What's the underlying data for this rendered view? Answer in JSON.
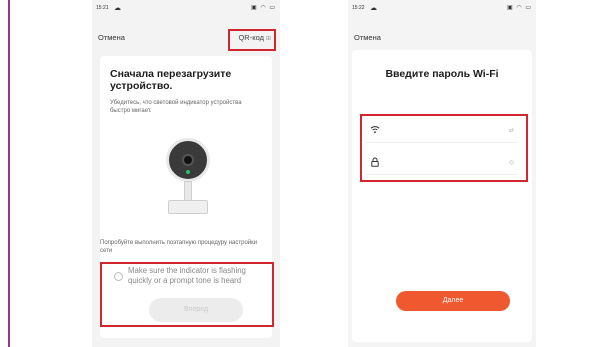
{
  "colors": {
    "highlight_box": "#d0262e",
    "primary_button": "#f0582f",
    "disabled_button": "#ececec",
    "page_rule": "#8e3a8a",
    "camera_led": "#26c46a"
  },
  "screen1": {
    "status": {
      "time": "15:21",
      "left_icon": "weather-icon",
      "right_icons": "signal wifi battery"
    },
    "cancel_label": "Отмена",
    "qr_label": "QR-код",
    "title": "Сначала перезагрузите устройство.",
    "subtitle": "Убедитесь, что световой индикатор устройства быстро мигает.",
    "hint": "Попробуйте выполнить поэтапную процедуру настройки сети",
    "confirm_text": "Make sure the indicator is flashing quickly or a prompt tone is heard",
    "next_label": "Вперед"
  },
  "screen2": {
    "status": {
      "time": "15:22",
      "left_icon": "weather-icon",
      "right_icons": "signal wifi battery"
    },
    "cancel_label": "Отмена",
    "title": "Введите пароль Wi-Fi",
    "ssid_value": "",
    "password_value": "",
    "submit_label": "Далее"
  }
}
